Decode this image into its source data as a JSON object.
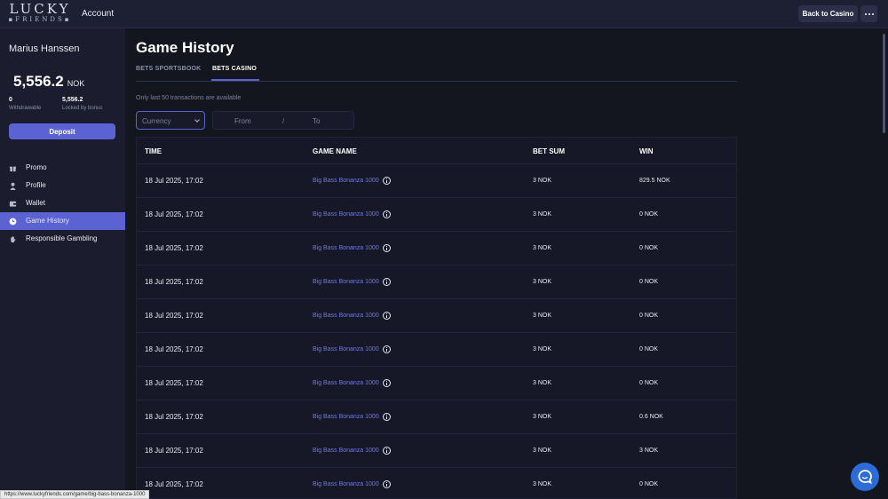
{
  "header": {
    "logo_main": "LUCKY",
    "logo_sub": "FRIENDS",
    "account_label": "Account",
    "back_label": "Back to Casino",
    "more_icon": "more-horizontal-icon"
  },
  "sidebar": {
    "user_name": "Marius Hanssen",
    "balance": "5,556.2",
    "currency": "NOK",
    "withdrawable_value": "0",
    "withdrawable_label": "Withdrawable",
    "locked_value": "5,556.2",
    "locked_label": "Locked by bonus",
    "deposit_label": "Deposit",
    "nav": [
      {
        "label": "Promo",
        "icon": "gift-icon",
        "active": false
      },
      {
        "label": "Profile",
        "icon": "user-icon",
        "active": false
      },
      {
        "label": "Wallet",
        "icon": "wallet-icon",
        "active": false
      },
      {
        "label": "Game History",
        "icon": "history-icon",
        "active": true
      },
      {
        "label": "Responsible Gambling",
        "icon": "hand-icon",
        "active": false
      }
    ]
  },
  "main": {
    "title": "Game History",
    "tabs": [
      {
        "label": "BETS SPORTSBOOK",
        "active": false
      },
      {
        "label": "BETS CASINO",
        "active": true
      }
    ],
    "note": "Only last 50 transactions are available",
    "filters": {
      "currency_placeholder": "Currency",
      "from_placeholder": "From",
      "separator": "/",
      "to_placeholder": "To"
    },
    "table": {
      "headers": [
        "TIME",
        "GAME NAME",
        "BET SUM",
        "WIN"
      ],
      "rows": [
        {
          "time": "18 Jul 2025, 17:02",
          "game": "Big Bass Bonanza 1000",
          "bet": "3 NOK",
          "win": "829.5 NOK"
        },
        {
          "time": "18 Jul 2025, 17:02",
          "game": "Big Bass Bonanza 1000",
          "bet": "3 NOK",
          "win": "0 NOK"
        },
        {
          "time": "18 Jul 2025, 17:02",
          "game": "Big Bass Bonanza 1000",
          "bet": "3 NOK",
          "win": "0 NOK"
        },
        {
          "time": "18 Jul 2025, 17:02",
          "game": "Big Bass Bonanza 1000",
          "bet": "3 NOK",
          "win": "0 NOK"
        },
        {
          "time": "18 Jul 2025, 17:02",
          "game": "Big Bass Bonanza 1000",
          "bet": "3 NOK",
          "win": "0 NOK"
        },
        {
          "time": "18 Jul 2025, 17:02",
          "game": "Big Bass Bonanza 1000",
          "bet": "3 NOK",
          "win": "0 NOK"
        },
        {
          "time": "18 Jul 2025, 17:02",
          "game": "Big Bass Bonanza 1000",
          "bet": "3 NOK",
          "win": "0 NOK"
        },
        {
          "time": "18 Jul 2025, 17:02",
          "game": "Big Bass Bonanza 1000",
          "bet": "3 NOK",
          "win": "0.6 NOK"
        },
        {
          "time": "18 Jul 2025, 17:02",
          "game": "Big Bass Bonanza 1000",
          "bet": "3 NOK",
          "win": "3 NOK"
        },
        {
          "time": "18 Jul 2025, 17:02",
          "game": "Big Bass Bonanza 1000",
          "bet": "3 NOK",
          "win": "0 NOK"
        }
      ]
    }
  },
  "status_url": "https://www.luckyfriends.com/game/big-bass-bonanza-1000",
  "chat_icon": "chat-bubble-icon",
  "colors": {
    "accent": "#5b63d3",
    "link": "#6f79e8",
    "chat": "#2b6cd8",
    "background": "#13151f"
  }
}
